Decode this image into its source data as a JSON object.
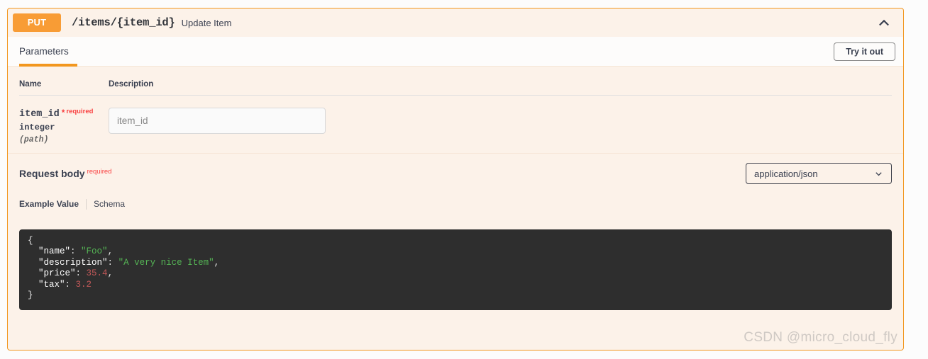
{
  "operation": {
    "method": "PUT",
    "path": "/items/{item_id}",
    "summary": "Update Item",
    "collapse_icon": "chevron-up-icon",
    "method_color": "#f89c35",
    "border_color": "#f2971f",
    "panel_background": "#fcf2e9"
  },
  "tabs": {
    "parameters_label": "Parameters",
    "try_it_out_label": "Try it out"
  },
  "parameters": {
    "columns": {
      "name": "Name",
      "description": "Description"
    },
    "rows": [
      {
        "name": "item_id",
        "required_star": "*",
        "required_label": "required",
        "type": "integer",
        "in": "(path)",
        "input_value": "",
        "input_placeholder": "item_id"
      }
    ]
  },
  "request_body": {
    "title": "Request body",
    "required_label": "required",
    "content_type": "application/json",
    "content_type_options": [
      "application/json"
    ],
    "chevron_icon": "chevron-down-icon"
  },
  "example": {
    "tab_example_label": "Example Value",
    "tab_schema_label": "Schema",
    "code": {
      "line_open": "{",
      "line_close": "}",
      "fields": [
        {
          "key": "\"name\"",
          "value": "\"Foo\"",
          "kind": "string",
          "comma": ","
        },
        {
          "key": "\"description\"",
          "value": "\"A very nice Item\"",
          "kind": "string",
          "comma": ","
        },
        {
          "key": "\"price\"",
          "value": "35.4",
          "kind": "number",
          "comma": ","
        },
        {
          "key": "\"tax\"",
          "value": "3.2",
          "kind": "number",
          "comma": ""
        }
      ]
    },
    "colors": {
      "background": "#2e2e2e",
      "key": "#ffffff",
      "string": "#55b555",
      "number": "#c25858"
    }
  },
  "watermark": {
    "text": "CSDN @micro_cloud_fly"
  }
}
